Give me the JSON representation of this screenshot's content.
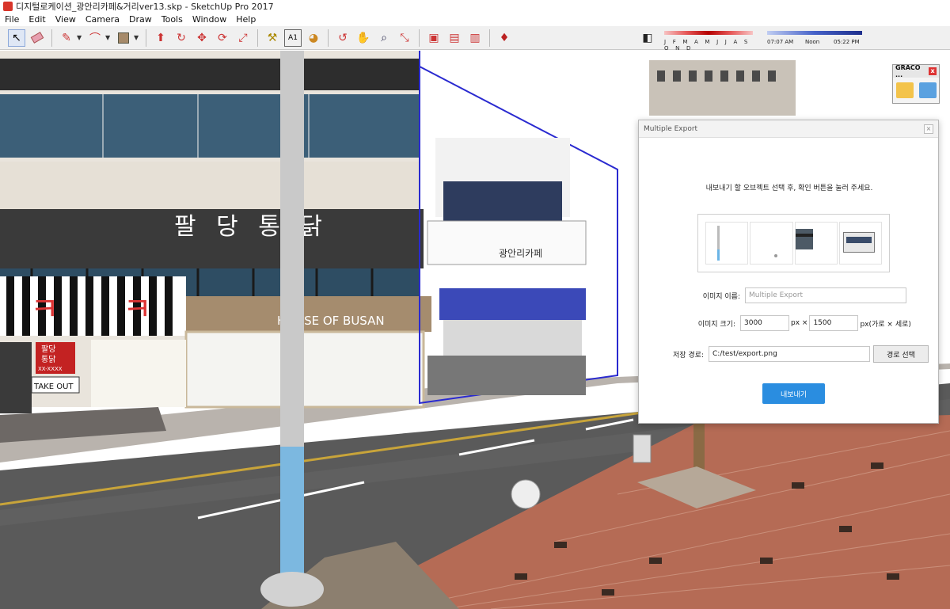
{
  "window": {
    "title": "디지털로케이션_광안리카페&거리ver13.skp - SketchUp Pro 2017"
  },
  "menu": [
    "File",
    "Edit",
    "View",
    "Camera",
    "Draw",
    "Tools",
    "Window",
    "Help"
  ],
  "toolbar": {
    "tools": [
      "select-tool",
      "eraser-tool",
      "pencil-tool",
      "arc-tool",
      "paint-bucket-tool",
      "push-pull-tool",
      "follow-me-tool",
      "move-tool",
      "rotate-tool",
      "scale-tool",
      "tape-measure-tool",
      "text-tool",
      "orbit-tool",
      "pan-tool",
      "zoom-tool",
      "zoom-extents-tool",
      "3d-warehouse-tool",
      "extension-warehouse-tool",
      "layout-tool",
      "ruby-tool"
    ]
  },
  "shadow_panel": {
    "months": "J F M A M J J A S O N D",
    "time_start": "07:07 AM",
    "time_noon": "Noon",
    "time_end": "05:22 PM"
  },
  "scene": {
    "store_sign_korean": "팔 당 통 닭",
    "store_sign_busan": "HOUSE OF BUSAN",
    "red_sign": "팔당\n통닭",
    "phone": "XX-XXXX",
    "takeout": "TAKE OUT"
  },
  "graco_panel": {
    "title": "GRACO ..."
  },
  "dialog": {
    "title": "Multiple Export",
    "instruction": "내보내기 할 오브젝트 선택 후, 확인 버튼을 눌러 주세요.",
    "image_name_label": "이미지 이름:",
    "image_name_placeholder": "Multiple Export",
    "image_size_label": "이미지 크기:",
    "width_value": "3000",
    "px_x": "px ×",
    "height_value": "1500",
    "px_suffix": "px(가로 × 세로)",
    "save_path_label": "저장 경로:",
    "save_path_value": "C:/test/export.png",
    "path_button": "경로 선택",
    "export_button": "내보내기"
  }
}
